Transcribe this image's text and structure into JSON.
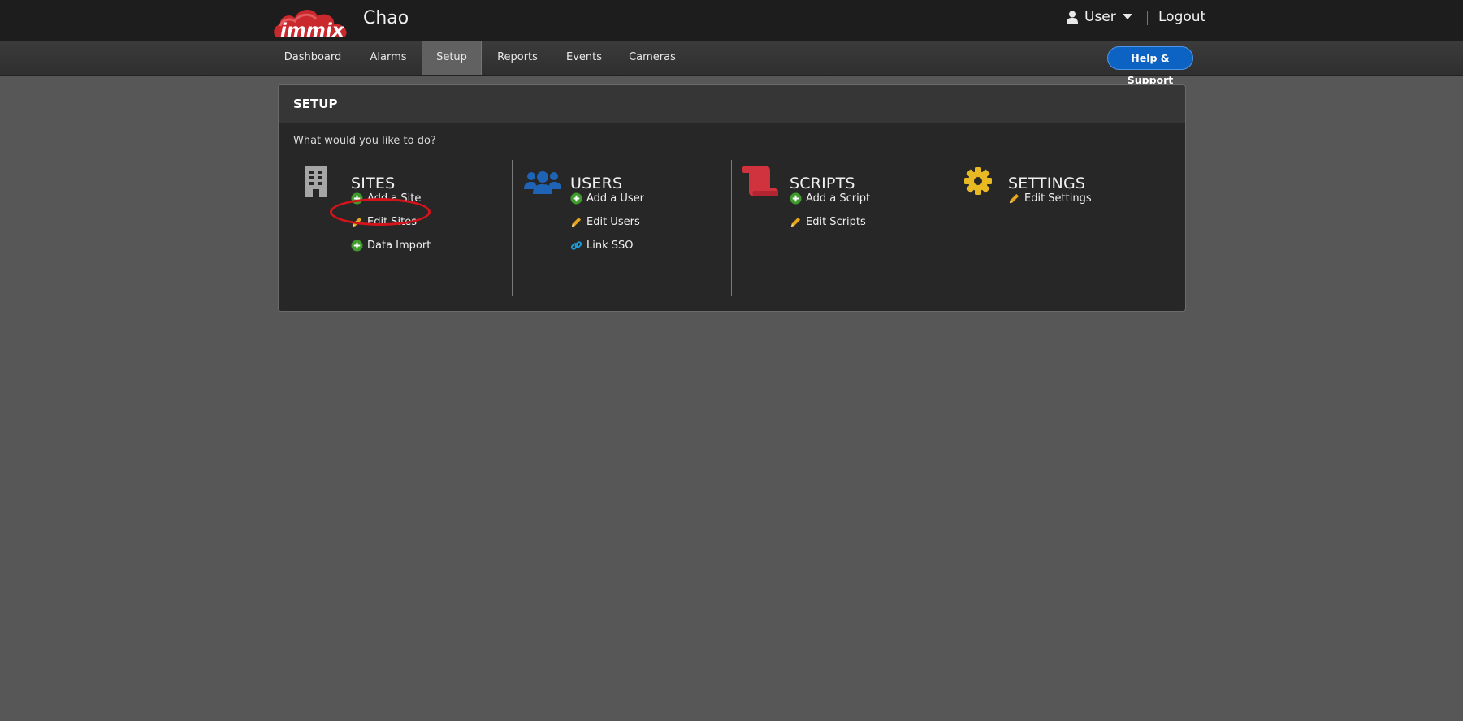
{
  "header": {
    "logo_text": "immix",
    "site_name": "Chao",
    "user_label": "User",
    "logout_label": "Logout",
    "icons": {
      "user": "user-icon",
      "caret": "caret-down-icon"
    }
  },
  "nav": {
    "tabs": [
      {
        "label": "Dashboard",
        "active": false
      },
      {
        "label": "Alarms",
        "active": false
      },
      {
        "label": "Setup",
        "active": true
      },
      {
        "label": "Reports",
        "active": false
      },
      {
        "label": "Events",
        "active": false
      },
      {
        "label": "Cameras",
        "active": false
      }
    ],
    "help_label": "Help & Support"
  },
  "panel": {
    "title": "SETUP",
    "prompt": "What would you like to do?",
    "sections": [
      {
        "title": "SITES",
        "icon": "building-icon",
        "actions": [
          {
            "label": "Add a Site",
            "icon": "plus-circle-icon"
          },
          {
            "label": "Edit Sites",
            "icon": "pencil-icon"
          },
          {
            "label": "Data Import",
            "icon": "plus-circle-icon"
          }
        ]
      },
      {
        "title": "USERS",
        "icon": "users-icon",
        "actions": [
          {
            "label": "Add a User",
            "icon": "plus-circle-icon"
          },
          {
            "label": "Edit Users",
            "icon": "pencil-icon"
          },
          {
            "label": "Link SSO",
            "icon": "link-icon"
          }
        ]
      },
      {
        "title": "SCRIPTS",
        "icon": "scroll-icon",
        "actions": [
          {
            "label": "Add a Script",
            "icon": "plus-circle-icon"
          },
          {
            "label": "Edit Scripts",
            "icon": "pencil-icon"
          }
        ]
      },
      {
        "title": "SETTINGS",
        "icon": "gear-icon",
        "actions": [
          {
            "label": "Edit Settings",
            "icon": "pencil-icon"
          }
        ]
      }
    ]
  },
  "colors": {
    "page_bg": "#575757",
    "topbar_bg": "#1d1d1d",
    "panel_bg": "#272727",
    "help_button": "#0d63c4",
    "logo_red": "#c9282d",
    "add_green": "#3f9a2c",
    "edit_yellow": "#e6a51c",
    "link_blue": "#1c9bd6",
    "users_blue": "#1f63b6",
    "scripts_red": "#d0333d",
    "settings_yellow": "#e8b923",
    "annotation_red": "#d4131a"
  }
}
